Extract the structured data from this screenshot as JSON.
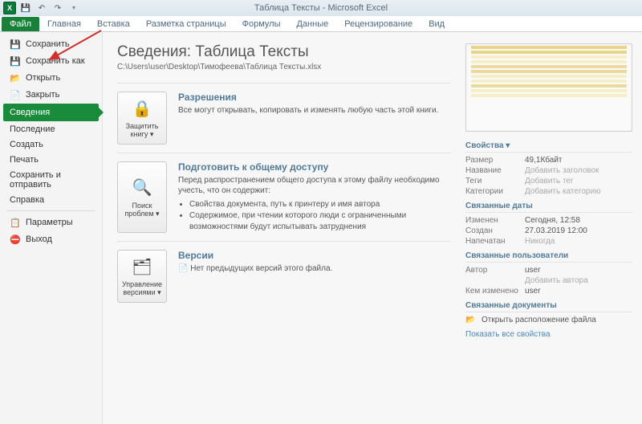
{
  "title": "Таблица Тексты - Microsoft Excel",
  "qat_excel": "X",
  "ribbon": {
    "tabs": [
      "Файл",
      "Главная",
      "Вставка",
      "Разметка страницы",
      "Формулы",
      "Данные",
      "Рецензирование",
      "Вид"
    ]
  },
  "sidebar": {
    "items": [
      {
        "icon": "💾",
        "label": "Сохранить"
      },
      {
        "icon": "💾",
        "label": "Сохранить как"
      },
      {
        "icon": "📂",
        "label": "Открыть"
      },
      {
        "icon": "📄",
        "label": "Закрыть"
      }
    ],
    "sel": "Сведения",
    "items2": [
      "Последние",
      "Создать",
      "Печать",
      "Сохранить и отправить",
      "Справка"
    ],
    "items3": [
      {
        "icon": "⚙",
        "label": "Параметры"
      },
      {
        "icon": "⛔",
        "label": "Выход"
      }
    ]
  },
  "page": {
    "title": "Сведения: Таблица Тексты",
    "path": "C:\\Users\\user\\Desktop\\Тимофеева\\Таблица Тексты.xlsx"
  },
  "sections": {
    "perm": {
      "btn_label": "Защитить книгу ▾",
      "title": "Разрешения",
      "text": "Все могут открывать, копировать и изменять любую часть этой книги."
    },
    "share": {
      "btn_label": "Поиск проблем ▾",
      "title": "Подготовить к общему доступу",
      "text": "Перед распространением общего доступа к этому файлу необходимо учесть, что он содержит:",
      "bullets": [
        "Свойства документа, путь к принтеру и имя автора",
        "Содержимое, при чтении которого люди с ограниченными возможностями будут испытывать затруднения"
      ]
    },
    "versions": {
      "btn_label": "Управление версиями ▾",
      "title": "Версии",
      "bullets": [
        "Нет предыдущих версий этого файла."
      ]
    }
  },
  "props": {
    "title": "Свойства ▾",
    "rows": [
      {
        "l": "Размер",
        "v": "49,1Кбайт"
      },
      {
        "l": "Название",
        "v": "Добавить заголовок",
        "faded": true
      },
      {
        "l": "Теги",
        "v": "Добавить тег",
        "faded": true
      },
      {
        "l": "Категории",
        "v": "Добавить категорию",
        "faded": true
      }
    ],
    "dates_title": "Связанные даты",
    "dates": [
      {
        "l": "Изменен",
        "v": "Сегодня, 12:58"
      },
      {
        "l": "Создан",
        "v": "27.03.2019 12:00"
      },
      {
        "l": "Напечатан",
        "v": "Никогда",
        "faded": true
      }
    ],
    "users_title": "Связанные пользователи",
    "users": [
      {
        "l": "Автор",
        "v": "user"
      },
      {
        "l": "",
        "v": "Добавить автора",
        "faded": true
      },
      {
        "l": "Кем изменено",
        "v": "user"
      }
    ],
    "docs_title": "Связанные документы",
    "open_loc": "Открыть расположение файла",
    "show_all": "Показать все свойства"
  }
}
